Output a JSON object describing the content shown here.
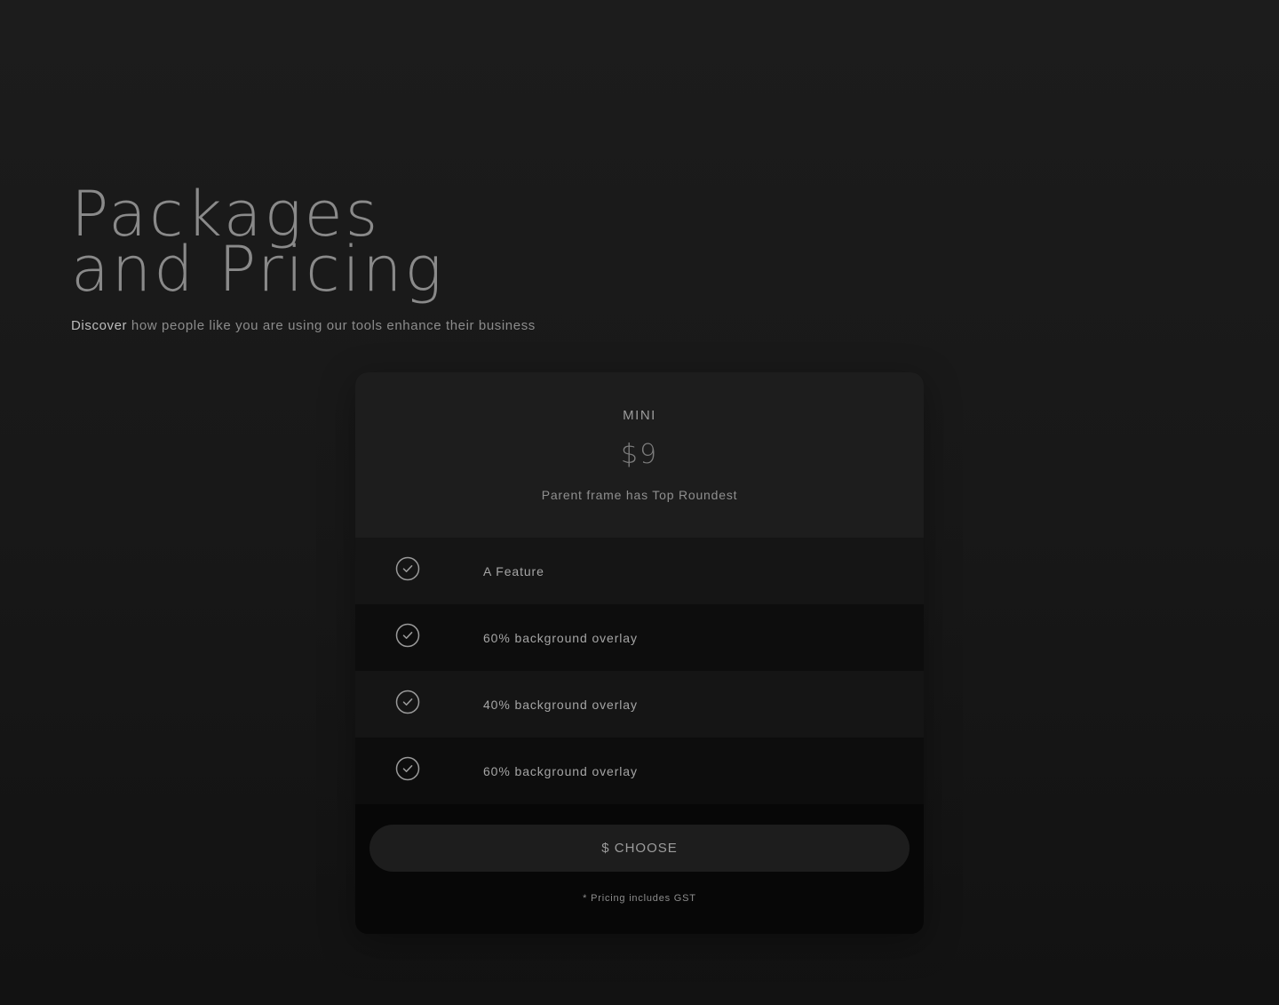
{
  "hero": {
    "title_line1": "Packages",
    "title_line2": "and Pricing",
    "subtitle_lead": "Discover",
    "subtitle_rest": " how people like you are using our tools enhance their business"
  },
  "card": {
    "tier_name": "MINI",
    "price": "$9",
    "description": "Parent frame has Top Roundest",
    "features": [
      {
        "label": "A Feature",
        "icon": "check-circle-icon"
      },
      {
        "label": "60% background overlay",
        "icon": "check-circle-icon"
      },
      {
        "label": "40% background overlay",
        "icon": "check-circle-icon"
      },
      {
        "label": "60% background overlay",
        "icon": "check-circle-icon"
      }
    ],
    "cta_label": "$ CHOOSE",
    "fine_print": "* Pricing includes GST"
  },
  "colors": {
    "page_background": "#1a1a1a",
    "card_header": "#1d1d1d",
    "card_footer": "#070707",
    "text_muted": "#9a9a9a"
  }
}
